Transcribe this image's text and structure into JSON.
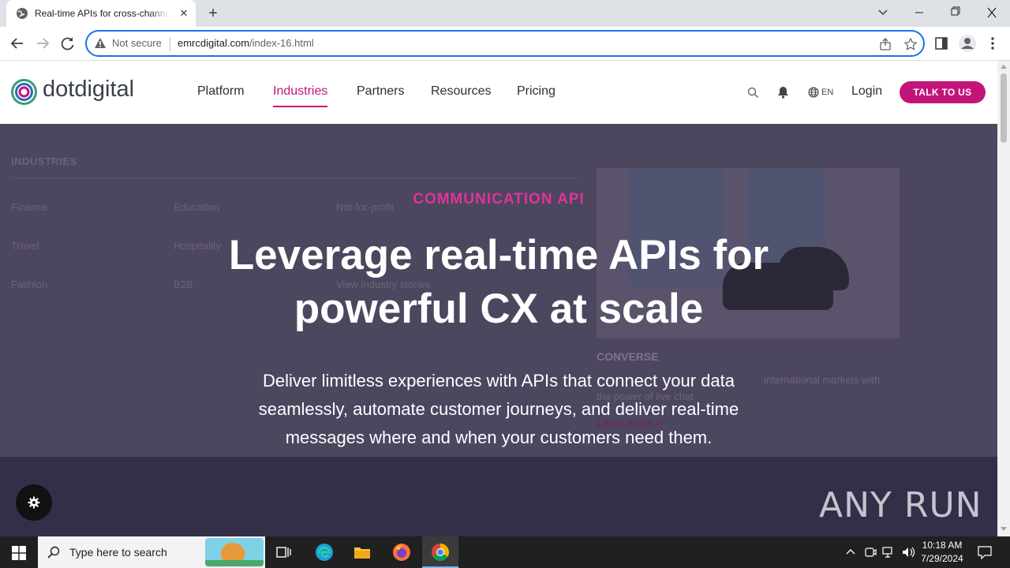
{
  "browser": {
    "tab_title": "Real-time APIs for cross-channel",
    "security_label": "Not secure",
    "url_host": "emrcdigital.com",
    "url_path": "/index-16.html"
  },
  "site": {
    "logo_text": "dotdigital",
    "nav": [
      "Platform",
      "Industries",
      "Partners",
      "Resources",
      "Pricing"
    ],
    "language": "EN",
    "login": "Login",
    "cta": "TALK TO US"
  },
  "menu": {
    "heading": "INDUSTRIES",
    "col1": [
      "Finance",
      "Travel",
      "Fashion"
    ],
    "col2": [
      "Education",
      "Hospitality",
      "B2B"
    ],
    "col3": [
      "Not-for-profit",
      "View industry stories"
    ],
    "card_brand": "CONVERSE",
    "card_text": "international markets with the power of live chat",
    "card_link": "Learn more"
  },
  "hero": {
    "kicker": "COMMUNICATION API",
    "title": "Leverage real-time APIs for powerful CX at scale",
    "body": "Deliver limitless experiences with APIs that connect your data seamlessly, automate customer journeys, and deliver real-time messages where and when your customers need them."
  },
  "watermark": "ANY RUN",
  "taskbar": {
    "search_placeholder": "Type here to search",
    "time": "10:18 AM",
    "date": "7/29/2024"
  },
  "colors": {
    "accent": "#c3147a",
    "hero_bg": "#352e49",
    "menu_bg": "#4d465f"
  }
}
